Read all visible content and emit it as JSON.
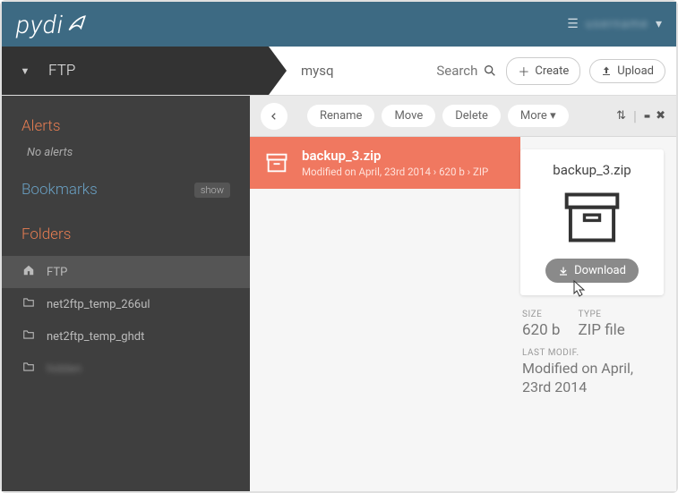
{
  "header": {
    "logo": "pydi",
    "user_label": "menu"
  },
  "subbar": {
    "workspace": "FTP",
    "breadcrumb": "mysq",
    "search_label": "Search",
    "create_label": "Create",
    "upload_label": "Upload"
  },
  "toolbar": {
    "rename": "Rename",
    "move": "Move",
    "delete": "Delete",
    "more": "More"
  },
  "sidebar": {
    "alerts_h": "Alerts",
    "no_alerts": "No alerts",
    "bookmarks_h": "Bookmarks",
    "show": "show",
    "folders_h": "Folders",
    "items": [
      {
        "label": "FTP",
        "icon": "home"
      },
      {
        "label": "net2ftp_temp_266ul",
        "icon": "folder"
      },
      {
        "label": "net2ftp_temp_ghdt",
        "icon": "folder"
      },
      {
        "label": "hidden",
        "icon": "folder",
        "blur": true
      }
    ]
  },
  "file": {
    "name": "backup_3.zip",
    "meta": "Modified on April, 23rd 2014 › 620 b › ZIP"
  },
  "detail": {
    "name": "backup_3.zip",
    "download": "Download",
    "size_lbl": "SIZE",
    "size_val": "620 b",
    "type_lbl": "TYPE",
    "type_val": "ZIP file",
    "mod_lbl": "LAST MODIF.",
    "mod_val": "Modified on April, 23rd 2014"
  }
}
